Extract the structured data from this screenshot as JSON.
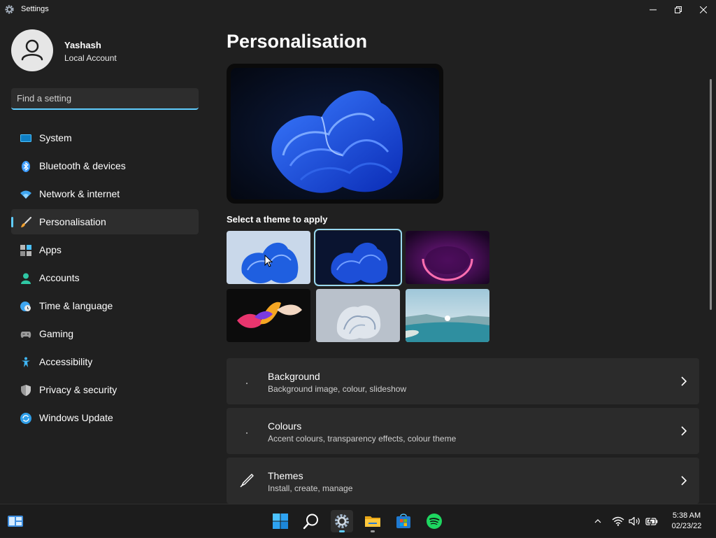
{
  "window": {
    "title": "Settings",
    "controls": [
      "minimize-icon",
      "restore-icon",
      "close-icon"
    ]
  },
  "user": {
    "name": "Yashash",
    "account_type": "Local Account"
  },
  "search": {
    "placeholder": "Find a setting"
  },
  "sidebar": {
    "items": [
      {
        "label": "System",
        "icon": "system-icon",
        "active": false
      },
      {
        "label": "Bluetooth & devices",
        "icon": "bluetooth-icon",
        "active": false
      },
      {
        "label": "Network & internet",
        "icon": "wifi-icon",
        "active": false
      },
      {
        "label": "Personalisation",
        "icon": "brush-icon",
        "active": true
      },
      {
        "label": "Apps",
        "icon": "apps-icon",
        "active": false
      },
      {
        "label": "Accounts",
        "icon": "person-icon",
        "active": false
      },
      {
        "label": "Time & language",
        "icon": "globe-clock-icon",
        "active": false
      },
      {
        "label": "Gaming",
        "icon": "gamepad-icon",
        "active": false
      },
      {
        "label": "Accessibility",
        "icon": "accessibility-icon",
        "active": false
      },
      {
        "label": "Privacy & security",
        "icon": "shield-icon",
        "active": false
      },
      {
        "label": "Windows Update",
        "icon": "update-icon",
        "active": false
      }
    ]
  },
  "main": {
    "title": "Personalisation",
    "theme_heading": "Select a theme to apply",
    "themes": [
      {
        "name": "light-bloom",
        "selected": false
      },
      {
        "name": "dark-bloom",
        "selected": true
      },
      {
        "name": "glow",
        "selected": false
      },
      {
        "name": "captured-motion",
        "selected": false
      },
      {
        "name": "flow",
        "selected": false
      },
      {
        "name": "sunrise",
        "selected": false
      }
    ],
    "cards": [
      {
        "title": "Background",
        "subtitle": "Background image, colour, slideshow",
        "icon": "image-icon"
      },
      {
        "title": "Colours",
        "subtitle": "Accent colours, transparency effects, colour theme",
        "icon": "palette-icon"
      },
      {
        "title": "Themes",
        "subtitle": "Install, create, manage",
        "icon": "pen-icon"
      }
    ]
  },
  "taskbar": {
    "apps": [
      "widgets-icon",
      "start-icon",
      "search-icon",
      "settings-icon",
      "file-explorer-icon",
      "store-icon",
      "spotify-icon"
    ],
    "tray": [
      "chevron-up-icon",
      "wifi-icon",
      "volume-icon",
      "battery-icon"
    ],
    "clock": {
      "time": "5:38 AM",
      "date": "02/23/22"
    }
  },
  "colors": {
    "accent": "#60cdff",
    "background": "#202020",
    "card": "#2b2b2b"
  }
}
